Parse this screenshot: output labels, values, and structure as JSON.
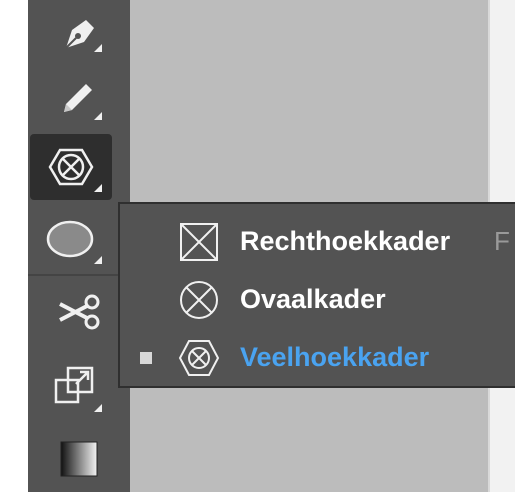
{
  "toolbar": {
    "tools": [
      {
        "icon": "pen-tool-icon"
      },
      {
        "icon": "pencil-tool-icon"
      },
      {
        "icon": "frame-tool-icon",
        "active": true
      },
      {
        "icon": "ellipse-tool-icon"
      },
      {
        "icon": "scissors-tool-icon"
      },
      {
        "icon": "free-transform-tool-icon"
      },
      {
        "icon": "gradient-swatch-tool-icon"
      }
    ]
  },
  "flyout": {
    "items": [
      {
        "label": "Rechthoekkader",
        "shortcut": "F",
        "icon": "rectangle-frame-icon",
        "selected": false
      },
      {
        "label": "Ovaalkader",
        "shortcut": "",
        "icon": "ellipse-frame-icon",
        "selected": false
      },
      {
        "label": "Veelhoekkader",
        "shortcut": "",
        "icon": "polygon-frame-icon",
        "selected": true
      }
    ]
  },
  "colors": {
    "toolbar_bg": "#535353",
    "canvas_bg": "#bcbcbc",
    "selected_text": "#4aa3f0"
  }
}
